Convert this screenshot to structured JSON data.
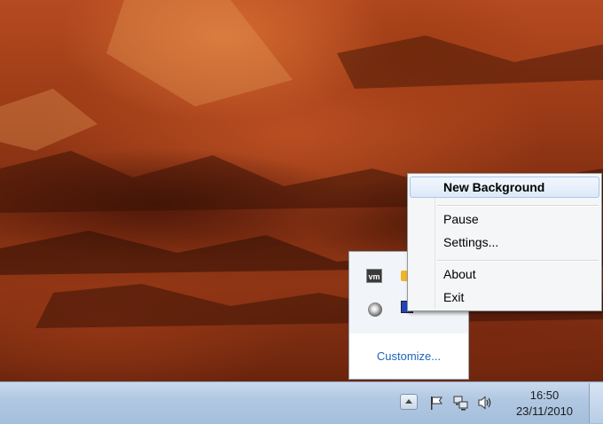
{
  "context_menu": {
    "items": [
      {
        "label": "New Background",
        "default": true
      },
      {
        "label": "Pause"
      },
      {
        "label": "Settings..."
      },
      {
        "label": "About"
      },
      {
        "label": "Exit"
      }
    ]
  },
  "tray_popup": {
    "icons": [
      "vmware-icon",
      "lock-icon",
      "disc-icon",
      "monitor-icon"
    ],
    "customize_label": "Customize..."
  },
  "taskbar": {
    "tray_icons": [
      "show-hidden-icons-button",
      "action-center-flag-icon",
      "network-icon",
      "volume-icon"
    ],
    "clock": {
      "time": "16:50",
      "date": "23/11/2010"
    }
  }
}
